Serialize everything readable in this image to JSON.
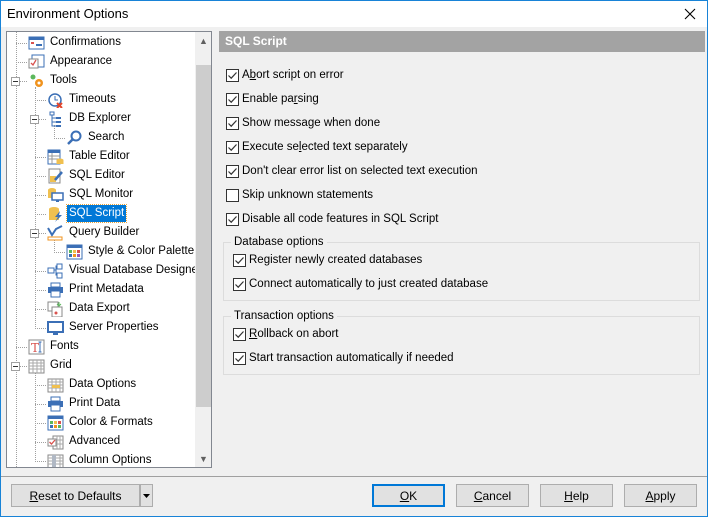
{
  "window": {
    "title": "Environment Options",
    "close_icon": "close-icon"
  },
  "tree": {
    "items": [
      {
        "label": "Confirmations",
        "icon": "confirmations-icon",
        "level": 1
      },
      {
        "label": "Appearance",
        "icon": "appearance-icon",
        "level": 1
      },
      {
        "label": "Tools",
        "icon": "tools-gear-icon",
        "level": 1,
        "expanded": true
      },
      {
        "label": "Timeouts",
        "icon": "timeouts-clock-icon",
        "level": 2
      },
      {
        "label": "DB Explorer",
        "icon": "db-explorer-tree-icon",
        "level": 2,
        "expanded": true
      },
      {
        "label": "Search",
        "icon": "search-icon",
        "level": 3
      },
      {
        "label": "Table Editor",
        "icon": "table-editor-icon",
        "level": 2
      },
      {
        "label": "SQL Editor",
        "icon": "sql-editor-icon",
        "level": 2
      },
      {
        "label": "SQL Monitor",
        "icon": "sql-monitor-icon",
        "level": 2
      },
      {
        "label": "SQL Script",
        "icon": "sql-script-icon",
        "level": 2,
        "selected": true
      },
      {
        "label": "Query Builder",
        "icon": "query-builder-icon",
        "level": 2,
        "expanded": true
      },
      {
        "label": "Style & Color Palette",
        "icon": "color-palette-icon",
        "level": 3
      },
      {
        "label": "Visual Database Designer",
        "icon": "database-designer-icon",
        "level": 2
      },
      {
        "label": "Print Metadata",
        "icon": "printer-icon",
        "level": 2
      },
      {
        "label": "Data Export",
        "icon": "data-export-icon",
        "level": 2
      },
      {
        "label": "Server Properties",
        "icon": "monitor-icon",
        "level": 2
      },
      {
        "label": "Fonts",
        "icon": "fonts-icon",
        "level": 1
      },
      {
        "label": "Grid",
        "icon": "grid-icon",
        "level": 1,
        "expanded": true
      },
      {
        "label": "Data Options",
        "icon": "data-options-grid-icon",
        "level": 2
      },
      {
        "label": "Print Data",
        "icon": "printer-icon",
        "level": 2
      },
      {
        "label": "Color & Formats",
        "icon": "color-formats-icon",
        "level": 2
      },
      {
        "label": "Advanced",
        "icon": "advanced-grid-icon",
        "level": 2
      },
      {
        "label": "Column Options",
        "icon": "column-options-icon",
        "level": 2
      }
    ],
    "scroll_position": 0.0
  },
  "main": {
    "section_title": "SQL Script",
    "options": [
      {
        "label": "Abort script on error",
        "accel": 1,
        "checked": true
      },
      {
        "label": "Enable parsing",
        "accel": 9,
        "checked": true
      },
      {
        "label": "Show message when done",
        "accel": -1,
        "checked": true
      },
      {
        "label": "Execute selected text separately",
        "accel": 10,
        "checked": true
      },
      {
        "label": "Don't clear error list on selected text execution",
        "accel": -1,
        "checked": true
      },
      {
        "label": "Skip unknown statements",
        "accel": -1,
        "checked": false
      },
      {
        "label": "Disable all code features in SQL Script",
        "accel": -1,
        "checked": true
      }
    ],
    "database_options": {
      "title": "Database options",
      "options": [
        {
          "label": "Register newly created databases",
          "accel": -1,
          "checked": true
        },
        {
          "label": "Connect automatically to just created database",
          "accel": -1,
          "checked": true
        }
      ]
    },
    "transaction_options": {
      "title": "Transaction options",
      "options": [
        {
          "label": "Rollback on abort",
          "accel": 0,
          "checked": true
        },
        {
          "label": "Start transaction automatically if needed",
          "accel": -1,
          "checked": true
        }
      ]
    }
  },
  "footer": {
    "reset_label": "Reset to Defaults",
    "reset_accel": 0,
    "ok_label": "OK",
    "ok_accel": 0,
    "cancel_label": "Cancel",
    "cancel_accel": 0,
    "help_label": "Help",
    "help_accel": 0,
    "apply_label": "Apply",
    "apply_accel": 0
  }
}
